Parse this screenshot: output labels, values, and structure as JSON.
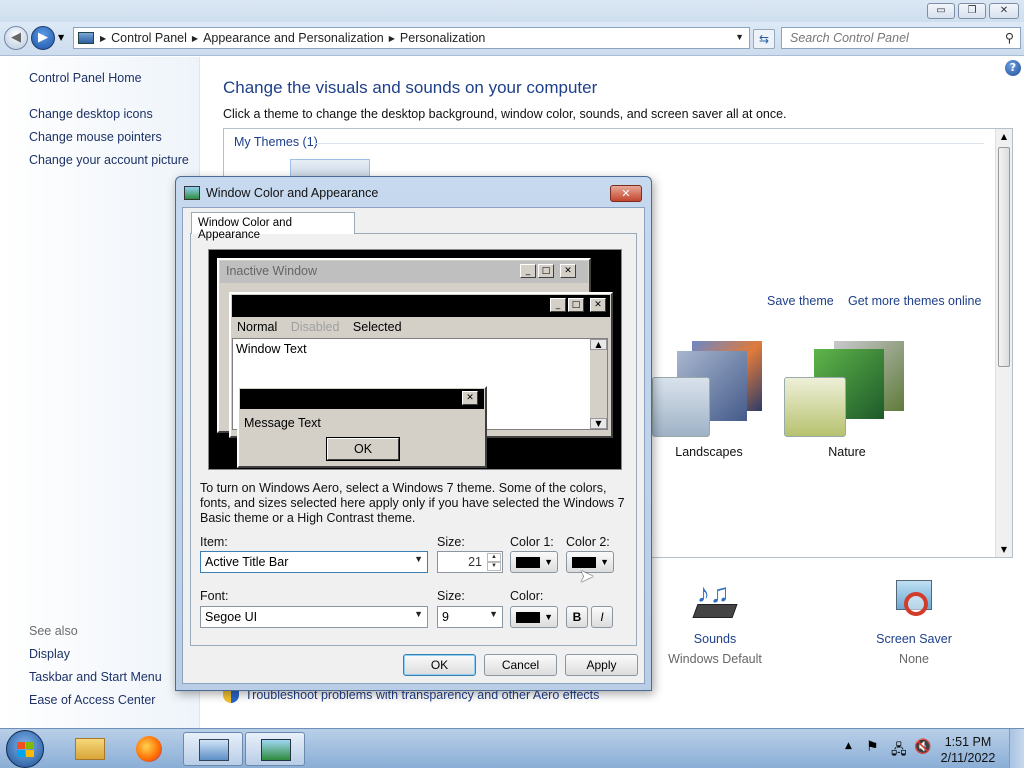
{
  "window": {
    "caption_buttons": {
      "minimize": "▭",
      "maximize": "❐",
      "close": "✕"
    }
  },
  "navbar": {
    "breadcrumbs": [
      "Control Panel",
      "Appearance and Personalization",
      "Personalization"
    ],
    "search_placeholder": "Search Control Panel"
  },
  "sidebar": {
    "items": [
      "Control Panel Home",
      "Change desktop icons",
      "Change mouse pointers",
      "Change your account picture"
    ],
    "see_also_label": "See also",
    "see_also_items": [
      "Display",
      "Taskbar and Start Menu",
      "Ease of Access Center"
    ]
  },
  "main": {
    "title": "Change the visuals and sounds on your computer",
    "subtitle": "Click a theme to change the desktop background, window color, sounds, and screen saver all at once.",
    "my_themes_label": "My Themes (1)",
    "save_theme": "Save theme",
    "get_more_themes": "Get more themes online",
    "themes": [
      "Landscapes",
      "Nature"
    ],
    "sounds_label": "Sounds",
    "sounds_value": "Windows Default",
    "screensaver_label": "Screen Saver",
    "screensaver_value": "None",
    "troubleshoot_link": "Troubleshoot problems with transparency and other Aero effects"
  },
  "dialog": {
    "title": "Window Color and Appearance",
    "tab": "Window Color and Appearance",
    "preview": {
      "inactive_title": "Inactive Window",
      "menu_normal": "Normal",
      "menu_disabled": "Disabled",
      "menu_selected": "Selected",
      "window_text": "Window Text",
      "message_text": "Message Text",
      "ok": "OK"
    },
    "info_text": "To turn on Windows Aero, select a Windows 7 theme.  Some of the colors, fonts, and sizes selected here apply only if you have selected the Windows 7 Basic theme or a High Contrast theme.",
    "item_label": "Item:",
    "item_value": "Active Title Bar",
    "size_label": "Size:",
    "size_value": "21",
    "color1_label": "Color 1:",
    "color2_label": "Color 2:",
    "font_label": "Font:",
    "font_value": "Segoe UI",
    "font_size_label": "Size:",
    "font_size_value": "9",
    "font_color_label": "Color:",
    "bold_label": "B",
    "italic_label": "I",
    "ok_label": "OK",
    "cancel_label": "Cancel",
    "apply_label": "Apply"
  },
  "taskbar": {
    "time": "1:51 PM",
    "date": "2/11/2022"
  },
  "colors": {
    "link": "#1e3f8a",
    "title_blue": "#1e3f8a",
    "dialog_frame": "#b9cde6",
    "taskbar": "#8aaed6"
  }
}
